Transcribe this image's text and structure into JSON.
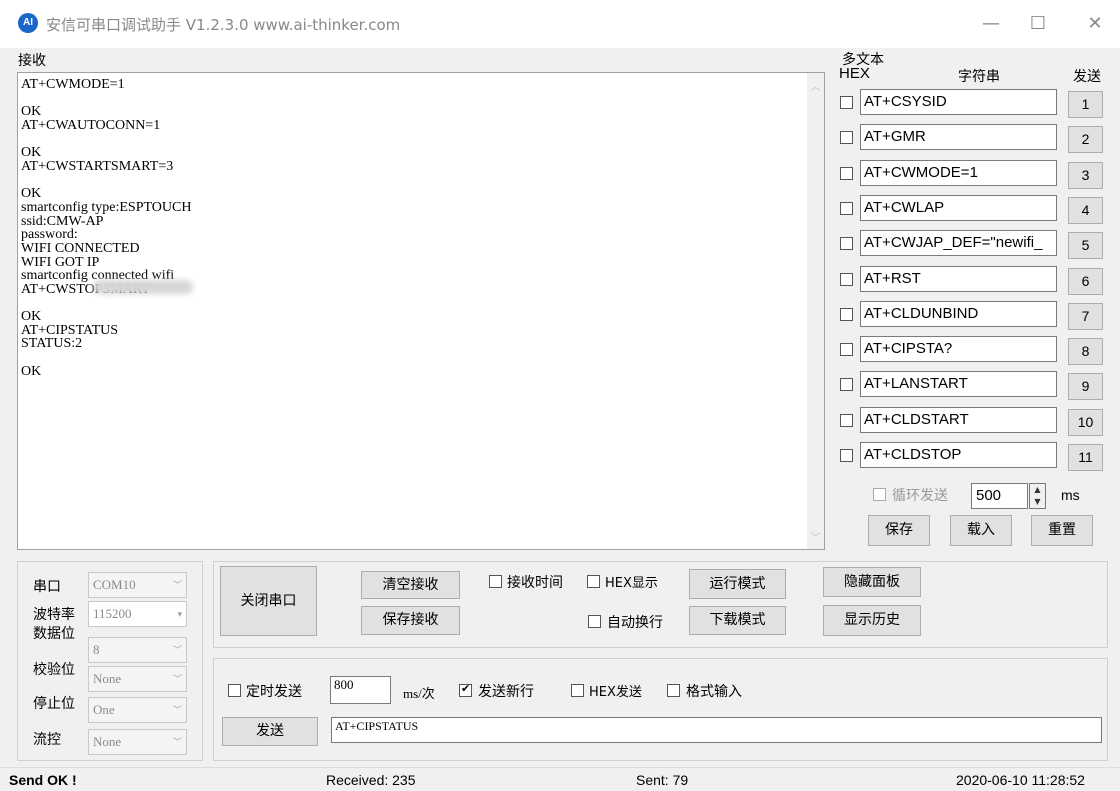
{
  "window": {
    "logo_text": "AI",
    "title": "安信可串口调试助手 V1.2.3.0    www.ai-thinker.com",
    "minimize_glyph": "—",
    "maximize_glyph": "☐",
    "close_glyph": "✕"
  },
  "receive": {
    "label": "接收",
    "text": "AT+CWMODE=1\n\nOK\nAT+CWAUTOCONN=1\n\nOK\nAT+CWSTARTSMART=3\n\nOK\nsmartconfig type:ESPTOUCH\nssid:CMW-AP\npassword:\nWIFI CONNECTED\nWIFI GOT IP\nsmartconfig connected wifi\nAT+CWSTOPSMART\n\nOK\nAT+CIPSTATUS\nSTATUS:2\n\nOK"
  },
  "multitext": {
    "label": "多文本",
    "hex_header": "HEX",
    "string_header": "字符串",
    "send_header": "发送",
    "rows": [
      {
        "value": "AT+CSYSID",
        "button": "1"
      },
      {
        "value": "AT+GMR",
        "button": "2"
      },
      {
        "value": "AT+CWMODE=1",
        "button": "3"
      },
      {
        "value": "AT+CWLAP",
        "button": "4"
      },
      {
        "value": "AT+CWJAP_DEF=\"newifi_",
        "button": "5"
      },
      {
        "value": "AT+RST",
        "button": "6"
      },
      {
        "value": "AT+CLDUNBIND",
        "button": "7"
      },
      {
        "value": "AT+CIPSTA?",
        "button": "8"
      },
      {
        "value": "AT+LANSTART",
        "button": "9"
      },
      {
        "value": "AT+CLDSTART",
        "button": "10"
      },
      {
        "value": "AT+CLDSTOP",
        "button": "11"
      }
    ],
    "loop_send_label": "循环发送",
    "loop_interval": "500",
    "loop_unit": "ms",
    "save_label": "保存",
    "load_label": "载入",
    "reset_label": "重置"
  },
  "serial": {
    "port_label": "串口",
    "port_value": "COM10",
    "baud_label": "波特率",
    "baud_value": "115200",
    "databits_label": "数据位",
    "databits_value": "8",
    "parity_label": "校验位",
    "parity_value": "None",
    "stopbits_label": "停止位",
    "stopbits_value": "One",
    "flow_label": "流控",
    "flow_value": "None"
  },
  "controls": {
    "close_port": "关闭串口",
    "clear_receive": "清空接收",
    "save_receive": "保存接收",
    "recv_time": "接收时间",
    "hex_display": "HEX显示",
    "auto_wrap": "自动换行",
    "run_mode": "运行模式",
    "download_mode": "下载模式",
    "hide_panel": "隐藏面板",
    "show_history": "显示历史"
  },
  "send": {
    "timed_send": "定时发送",
    "interval": "800",
    "interval_unit": "ms/次",
    "send_newline": "发送新行",
    "hex_send": "HEX发送",
    "format_input": "格式输入",
    "send_button": "发送",
    "send_text": "AT+CIPSTATUS"
  },
  "status": {
    "message": "Send OK !",
    "received": "Received: 235",
    "sent": "Sent: 79",
    "datetime": "2020-06-10 11:28:52"
  }
}
